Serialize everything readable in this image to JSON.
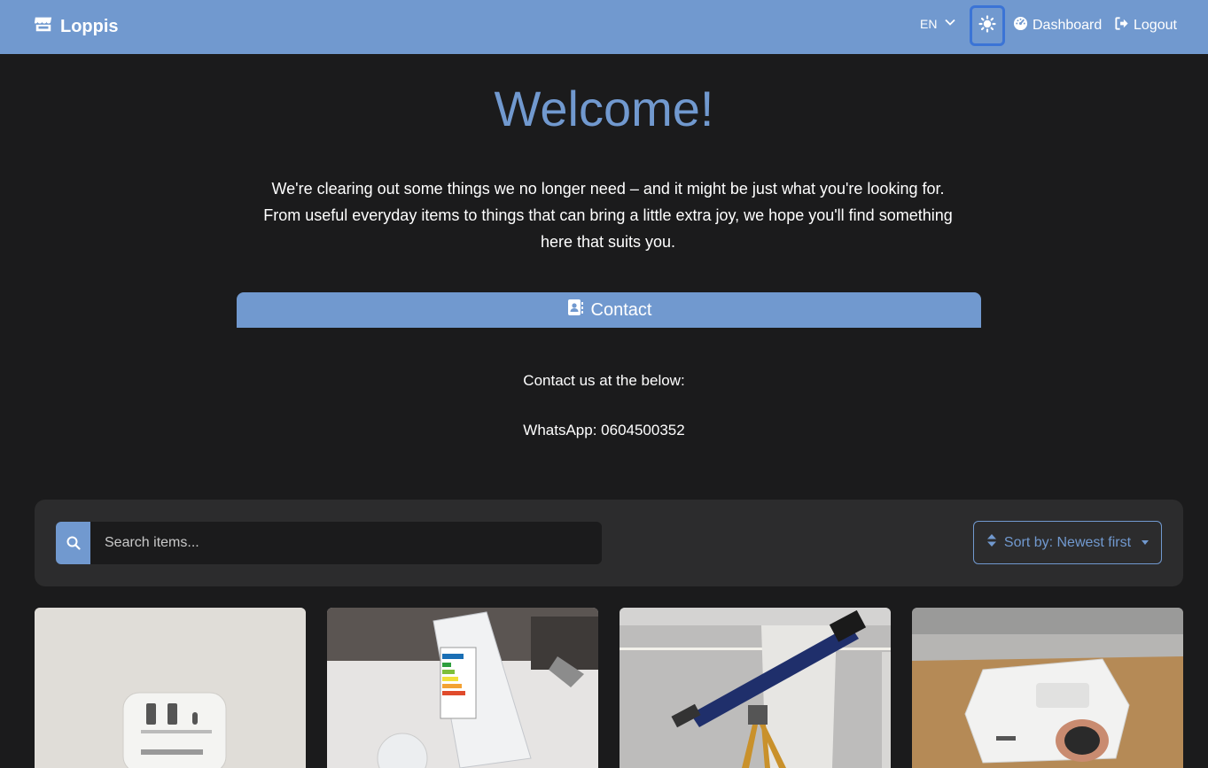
{
  "navbar": {
    "brand": "Loppis",
    "language": "EN",
    "dashboard_label": "Dashboard",
    "logout_label": "Logout"
  },
  "hero": {
    "title": "Welcome!",
    "intro": "We're clearing out some things we no longer need – and it might be just what you're looking for. From useful everyday items to things that can bring a little extra joy, we hope you'll find something here that suits you."
  },
  "contact": {
    "heading": "Contact",
    "line1": "Contact us at the below:",
    "line2": "WhatsApp: 0604500352"
  },
  "filters": {
    "search_placeholder": "Search items...",
    "sort_label": "Sort by: Newest first"
  },
  "items": [
    {
      "image_icon": "usb-charger-photo"
    },
    {
      "image_icon": "light-bulb-photo"
    },
    {
      "image_icon": "telescope-photo"
    },
    {
      "image_icon": "projector-photo"
    }
  ],
  "colors": {
    "accent": "#7199cf",
    "background": "#1b1b1c",
    "panel": "#2c2c2d",
    "focus_ring": "#3b74d6"
  }
}
